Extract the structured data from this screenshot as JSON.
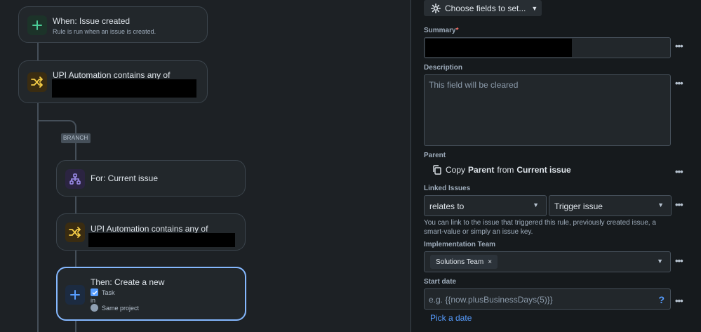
{
  "flow": {
    "trigger": {
      "title": "When: Issue created",
      "subtitle": "Rule is run when an issue is created."
    },
    "condition1": {
      "title": "UPI Automation contains any of"
    },
    "branch_badge": "BRANCH",
    "branch_node": {
      "title": "For: Current issue"
    },
    "condition2": {
      "title": "UPI Automation contains any of"
    },
    "action": {
      "title": "Then: Create a new",
      "issue_type": "Task",
      "in_label": "in",
      "project": "Same project"
    }
  },
  "panel": {
    "choose_fields_label": "Choose fields to set...",
    "summary": {
      "label": "Summary",
      "required_mark": "*"
    },
    "description": {
      "label": "Description",
      "placeholder": "This field will be cleared"
    },
    "parent": {
      "label": "Parent",
      "copy_prefix": "Copy",
      "copy_field": "Parent",
      "copy_mid": "from",
      "copy_source": "Current issue"
    },
    "linked_issues": {
      "label": "Linked Issues",
      "relation": "relates to",
      "target": "Trigger issue",
      "helper": "You can link to the issue that triggered this rule, previously created issue, a smart-value or simply an issue key."
    },
    "implementation_team": {
      "label": "Implementation Team",
      "chip": "Solutions Team",
      "chip_remove": "×"
    },
    "start_date": {
      "label": "Start date",
      "placeholder": "e.g. {{now.plusBusinessDays(5)}}",
      "help": "?",
      "pick_link": "Pick a date"
    },
    "more_actions": "•••"
  },
  "colors": {
    "accent": "#579dff",
    "selected_border": "#85b8ff",
    "trigger_icon": "#4bce97",
    "condition_icon": "#f5cd47",
    "branch_icon": "#9f8fef"
  }
}
